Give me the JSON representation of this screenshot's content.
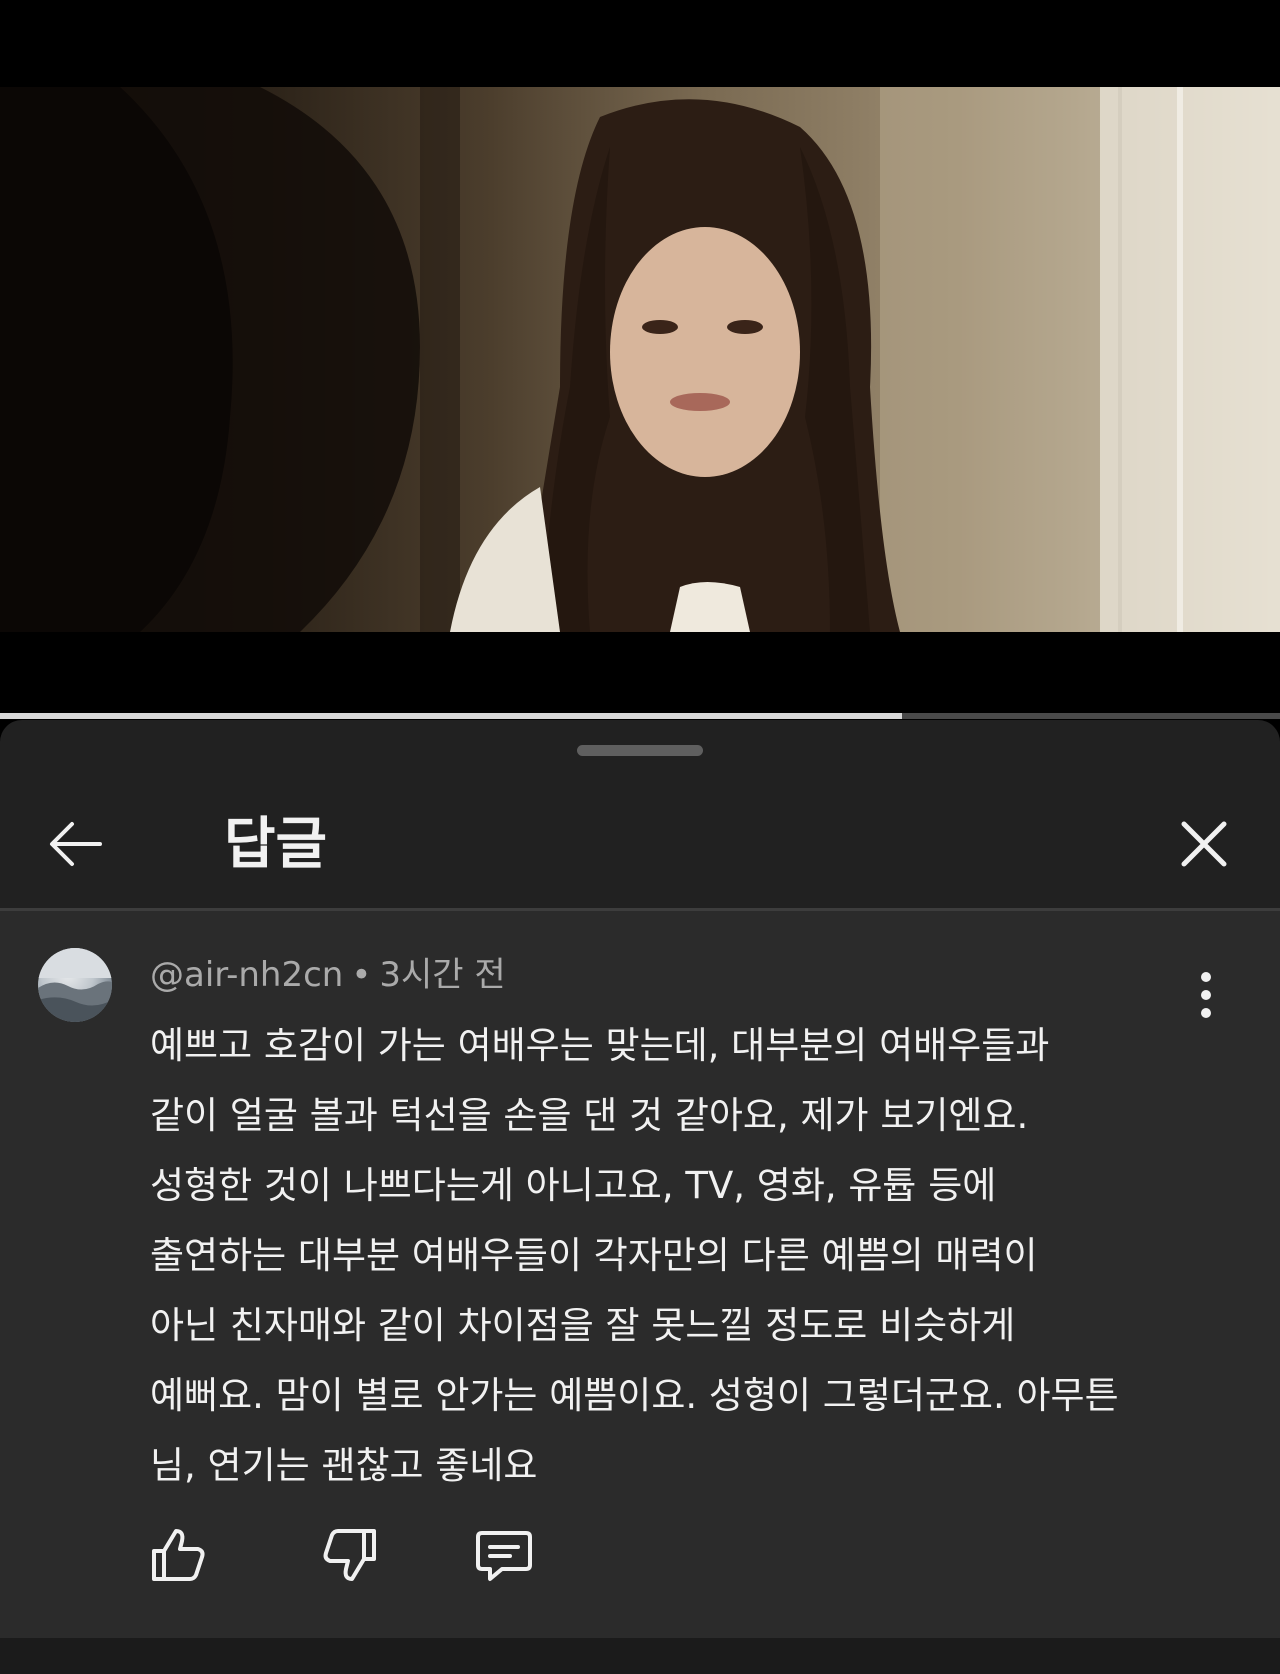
{
  "player": {
    "progress_fraction": 0.705
  },
  "replies_panel": {
    "title": "답글",
    "icons": {
      "back": "arrow-left-icon",
      "close": "close-icon"
    },
    "comment": {
      "author": "@air-nh2cn",
      "separator": "•",
      "time": "3시간 전",
      "lines": [
        "예쁘고 호감이 가는 여배우는 맞는데, 대부분의 여배우들과",
        "같이 얼굴 볼과 턱선을 손을 댄 것 같아요, 제가 보기엔요.",
        "성형한 것이 나쁘다는게 아니고요, TV, 영화, 유튭 등에",
        "출연하는 대부분 여배우들이 각자만의 다른 예쁨의 매력이",
        "아닌 친자매와 같이 차이점을 잘 못느낄 정도로 비슷하게",
        "예뻐요. 맘이 별로 안가는 예쁨이요. 성형이 그렇더군요. 아무튼",
        "님, 연기는 괜찮고 좋네요"
      ],
      "actions": [
        "like-icon",
        "dislike-icon",
        "reply-icon"
      ],
      "more_icon": "more-vert-icon"
    }
  },
  "colors": {
    "panel_bg": "#212121",
    "comment_bg": "#2b2b2b",
    "text_primary": "#f1f1f1",
    "text_secondary": "#aaaaaa"
  }
}
